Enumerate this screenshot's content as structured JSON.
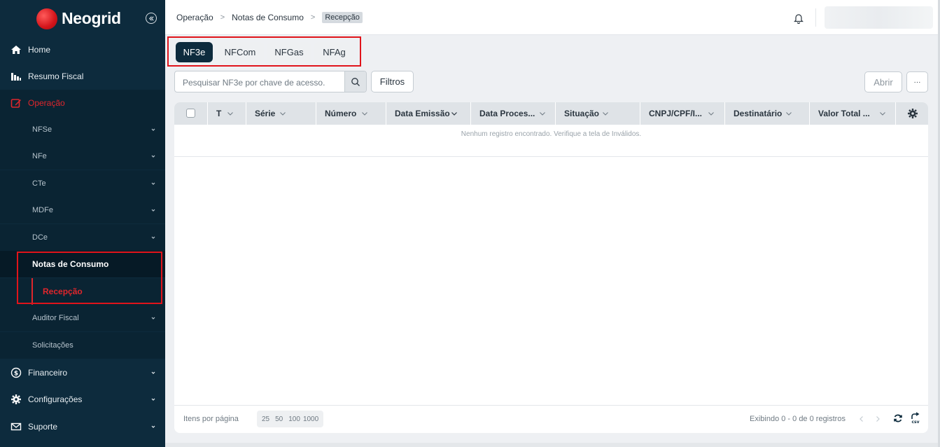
{
  "brand": {
    "name": "Neogrid"
  },
  "colors": {
    "sidebar": "#0d2b3d",
    "accent": "#e0262c",
    "active_tab": "#0d2b3d"
  },
  "sidebar": {
    "items": [
      {
        "label": "Home",
        "icon": "home-icon"
      },
      {
        "label": "Resumo Fiscal",
        "icon": "chart-icon"
      },
      {
        "label": "Operação",
        "icon": "edit-icon"
      },
      {
        "label": "Financeiro",
        "icon": "dollar-icon"
      },
      {
        "label": "Configurações",
        "icon": "gear-icon"
      },
      {
        "label": "Suporte",
        "icon": "mail-icon"
      }
    ],
    "operacao_children": [
      {
        "label": "NFSe"
      },
      {
        "label": "NFe"
      },
      {
        "label": "CTe"
      },
      {
        "label": "MDFe"
      },
      {
        "label": "DCe"
      },
      {
        "label": "Notas de Consumo"
      },
      {
        "label": "Recepção"
      },
      {
        "label": "Auditor Fiscal"
      },
      {
        "label": "Solicitações"
      }
    ]
  },
  "breadcrumb": {
    "items": [
      "Operação",
      "Notas de Consumo",
      "Recepção"
    ]
  },
  "tabs": [
    {
      "label": "NF3e"
    },
    {
      "label": "NFCom"
    },
    {
      "label": "NFGas"
    },
    {
      "label": "NFAg"
    }
  ],
  "search": {
    "placeholder": "Pesquisar NF3e por chave de acesso."
  },
  "toolbar": {
    "filters_label": "Filtros",
    "open_label": "Abrir",
    "more_label": "···"
  },
  "table": {
    "columns": [
      "T",
      "Série",
      "Número",
      "Data Emissão",
      "Data Proces...",
      "Situação",
      "CNPJ/CPF/I...",
      "Destinatário",
      "Valor Total ..."
    ],
    "empty_message": "Nenhum registro encontrado. Verifique a tela de Inválidos."
  },
  "footer": {
    "per_page_label": "Itens por página",
    "per_page_options": [
      "25",
      "50",
      "100",
      "1000"
    ],
    "showing": "Exibindo 0 - 0 de 0 registros"
  }
}
